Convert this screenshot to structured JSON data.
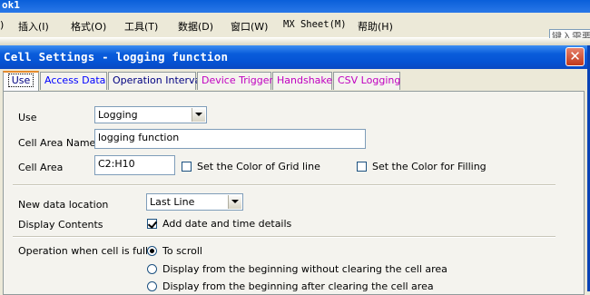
{
  "excel": {
    "title_fragment": "ok1",
    "menus": [
      "插入(I)",
      "格式(O)",
      "工具(T)",
      "数据(D)",
      "窗口(W)",
      "MX Sheet(M)",
      "帮助(H)"
    ],
    "menu_prefix": ")",
    "help_placeholder": "键入需要"
  },
  "dialog": {
    "title": "Cell Settings - logging function",
    "close_glyph": "✕",
    "tabs": [
      {
        "label": "Use",
        "color": "#000080"
      },
      {
        "label": "Access Data",
        "color": "#0000ff"
      },
      {
        "label": "Operation Interval",
        "color": "#000080"
      },
      {
        "label": "Device Trigger",
        "color": "#c000c0"
      },
      {
        "label": "Handshake",
        "color": "#c000c0"
      },
      {
        "label": "CSV Logging",
        "color": "#c000c0"
      }
    ],
    "use": {
      "label": "Use",
      "value": "Logging"
    },
    "cell_area_name": {
      "label": "Cell Area Name",
      "value": "logging function"
    },
    "cell_area": {
      "label": "Cell Area",
      "value": "C2:H10"
    },
    "grid_color": {
      "label": "Set the Color of Grid line",
      "checked": false
    },
    "fill_color": {
      "label": "Set the Color for Filling",
      "checked": false
    },
    "new_data_location": {
      "label": "New data location",
      "value": "Last Line"
    },
    "display_contents": {
      "label": "Display Contents",
      "add_datetime_label": "Add date and time details",
      "checked": true
    },
    "operation_when_full": {
      "label": "Operation when cell is full",
      "options": [
        {
          "label": "To scroll",
          "selected": true
        },
        {
          "label": "Display from the beginning without clearing the cell area",
          "selected": false
        },
        {
          "label": "Display from the beginning after clearing the cell area",
          "selected": false
        }
      ]
    }
  }
}
